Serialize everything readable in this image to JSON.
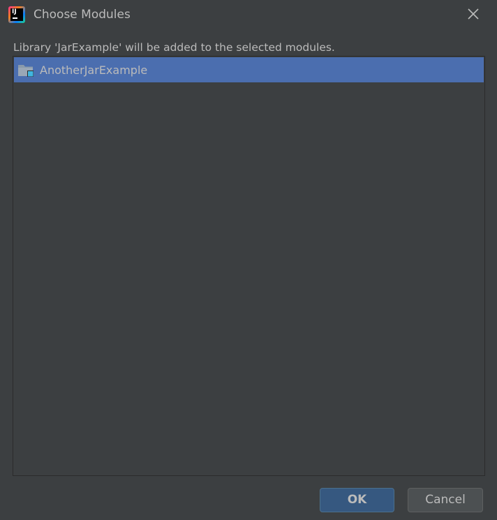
{
  "window": {
    "title": "Choose Modules",
    "app_icon": "intellij-idea-icon",
    "close_icon": "close-icon"
  },
  "dialog": {
    "message": "Library 'JarExample' will be added to the selected modules."
  },
  "module_list": {
    "items": [
      {
        "label": "AnotherJarExample",
        "icon": "module-folder-icon",
        "selected": true
      }
    ]
  },
  "buttons": {
    "ok_label": "OK",
    "cancel_label": "Cancel"
  },
  "colors": {
    "background": "#3c3f41",
    "selection": "#4b6eaf",
    "text": "#bbbbbb",
    "ok_button": "#365880",
    "cancel_button": "#4c5052"
  }
}
